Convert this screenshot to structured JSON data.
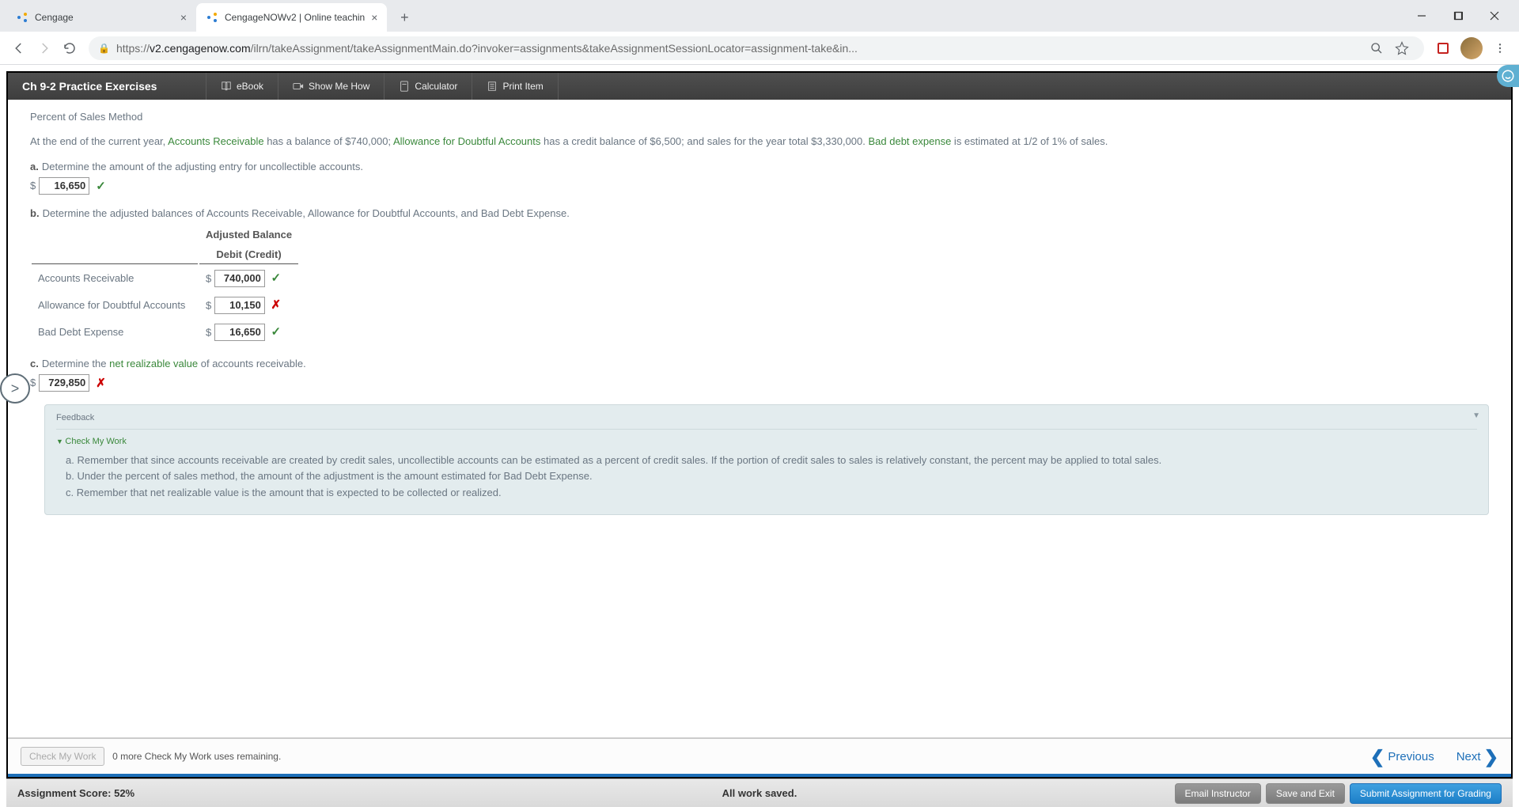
{
  "window": {
    "tabs": [
      {
        "title": "Cengage"
      },
      {
        "title": "CengageNOWv2 | Online teachin"
      }
    ],
    "url_prefix": "https://",
    "url_host": "v2.cengagenow.com",
    "url_path": "/ilrn/takeAssignment/takeAssignmentMain.do?invoker=assignments&takeAssignmentSessionLocator=assignment-take&in..."
  },
  "toolbar": {
    "title": "Ch 9-2 Practice Exercises",
    "ebook": "eBook",
    "show_me_how": "Show Me How",
    "calculator": "Calculator",
    "print_item": "Print Item"
  },
  "content": {
    "method_title": "Percent of Sales Method",
    "intro": {
      "pre_ar": "At the end of the current year, ",
      "ar": "Accounts Receivable",
      "post_ar": " has a balance of $740,000; ",
      "allowance": "Allowance for Doubtful Accounts",
      "post_allowance": " has a credit balance of $6,500; and sales for the year total $3,330,000. ",
      "bad_debt": "Bad debt expense",
      "post_bd": " is estimated at 1/2 of 1% of sales."
    },
    "q_a": {
      "label": "a.",
      "text": "Determine the amount of the adjusting entry for uncollectible accounts.",
      "value": "16,650",
      "correct": true
    },
    "q_b": {
      "label": "b.",
      "text": "Determine the adjusted balances of Accounts Receivable, Allowance for Doubtful Accounts, and Bad Debt Expense.",
      "header1": "Adjusted Balance",
      "header2": "Debit (Credit)",
      "rows": [
        {
          "label": "Accounts Receivable",
          "value": "740,000",
          "correct": true
        },
        {
          "label": "Allowance for Doubtful Accounts",
          "value": "10,150",
          "correct": false
        },
        {
          "label": "Bad Debt Expense",
          "value": "16,650",
          "correct": true
        }
      ]
    },
    "q_c": {
      "label": "c.",
      "pre": "Determine the ",
      "term": "net realizable value",
      "post": " of accounts receivable.",
      "value": "729,850",
      "correct": false
    },
    "feedback": {
      "title": "Feedback",
      "cmw": "Check My Work",
      "items": [
        "a. Remember that since accounts receivable are created by credit sales, uncollectible accounts can be estimated as a percent of credit sales. If the portion of credit sales to sales is relatively constant, the percent may be applied to total sales.",
        "b. Under the percent of sales method, the amount of the adjustment is the amount estimated for Bad Debt Expense.",
        "c. Remember that net realizable value is the amount that is expected to be collected or realized."
      ]
    }
  },
  "footer": {
    "cmw_btn": "Check My Work",
    "cmw_remaining": "0 more Check My Work uses remaining.",
    "previous": "Previous",
    "next": "Next"
  },
  "status": {
    "score": "Assignment Score: 52%",
    "saved": "All work saved.",
    "email": "Email Instructor",
    "save_exit": "Save and Exit",
    "submit": "Submit Assignment for Grading"
  }
}
